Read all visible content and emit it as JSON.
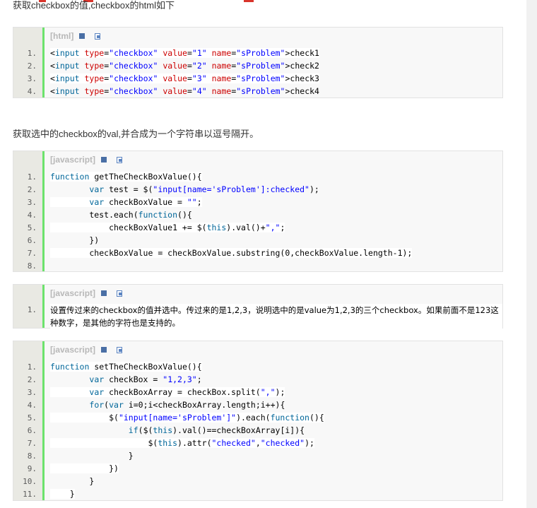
{
  "intro": "获取checkbox的值,checkbox的html如下",
  "paragraph": "获取选中的checkbox的val,并合成为一个字符串以逗号隔开。",
  "blocks": [
    {
      "lang": "[html]",
      "lines": [
        {
          "n": "1.",
          "t": "<input type=\"checkbox\" value=\"1\" name=\"sProblem\">check1"
        },
        {
          "n": "2.",
          "t": "<input type=\"checkbox\" value=\"2\" name=\"sProblem\">check2"
        },
        {
          "n": "3.",
          "t": "<input type=\"checkbox\" value=\"3\" name=\"sProblem\">check3"
        },
        {
          "n": "4.",
          "t": "<input type=\"checkbox\" value=\"4\" name=\"sProblem\">check4"
        }
      ]
    },
    {
      "lang": "[javascript]",
      "lines": [
        {
          "n": "1.",
          "t": "function getTheCheckBoxValue(){"
        },
        {
          "n": "2.",
          "t": "        var test = $(\"input[name='sProblem']:checked\");"
        },
        {
          "n": "3.",
          "t": "        var checkBoxValue = \"\";"
        },
        {
          "n": "4.",
          "t": "        test.each(function(){"
        },
        {
          "n": "5.",
          "t": "            checkBoxValue1 += $(this).val()+\",\";"
        },
        {
          "n": "6.",
          "t": "        })"
        },
        {
          "n": "7.",
          "t": "        checkBoxValue = checkBoxValue.substring(0,checkBoxValue.length-1);"
        },
        {
          "n": "8.",
          "t": ""
        }
      ]
    },
    {
      "lang": "[javascript]",
      "lines": [
        {
          "n": "1.",
          "t": "设置传过来的checkbox的值并选中。传过来的是1,2,3，说明选中的是value为1,2,3的三个checkbox。如果前面不是123这种数字，是其他的字符也是支持的。"
        }
      ]
    },
    {
      "lang": "[javascript]",
      "lines": [
        {
          "n": "1.",
          "t": "function setTheCheckBoxValue(){"
        },
        {
          "n": "2.",
          "t": "        var checkBox = \"1,2,3\";"
        },
        {
          "n": "3.",
          "t": "        var checkBoxArray = checkBox.split(\",\");"
        },
        {
          "n": "4.",
          "t": "        for(var i=0;i<checkBoxArray.length;i++){"
        },
        {
          "n": "5.",
          "t": "            $(\"input[name='sProblem']\").each(function(){"
        },
        {
          "n": "6.",
          "t": "                if($(this).val()==checkBoxArray[i]){"
        },
        {
          "n": "7.",
          "t": "                    $(this).attr(\"checked\",\"checked\");"
        },
        {
          "n": "8.",
          "t": "                }"
        },
        {
          "n": "9.",
          "t": "            })"
        },
        {
          "n": "10.",
          "t": "        }"
        },
        {
          "n": "11.",
          "t": "    }"
        }
      ]
    }
  ],
  "colors": {
    "gutter_border": "#6ce26c",
    "keyword": "#006699",
    "string": "#0000ff",
    "attr": "#cc0000"
  },
  "icons": [
    "view-source-icon",
    "copy-code-icon"
  ]
}
